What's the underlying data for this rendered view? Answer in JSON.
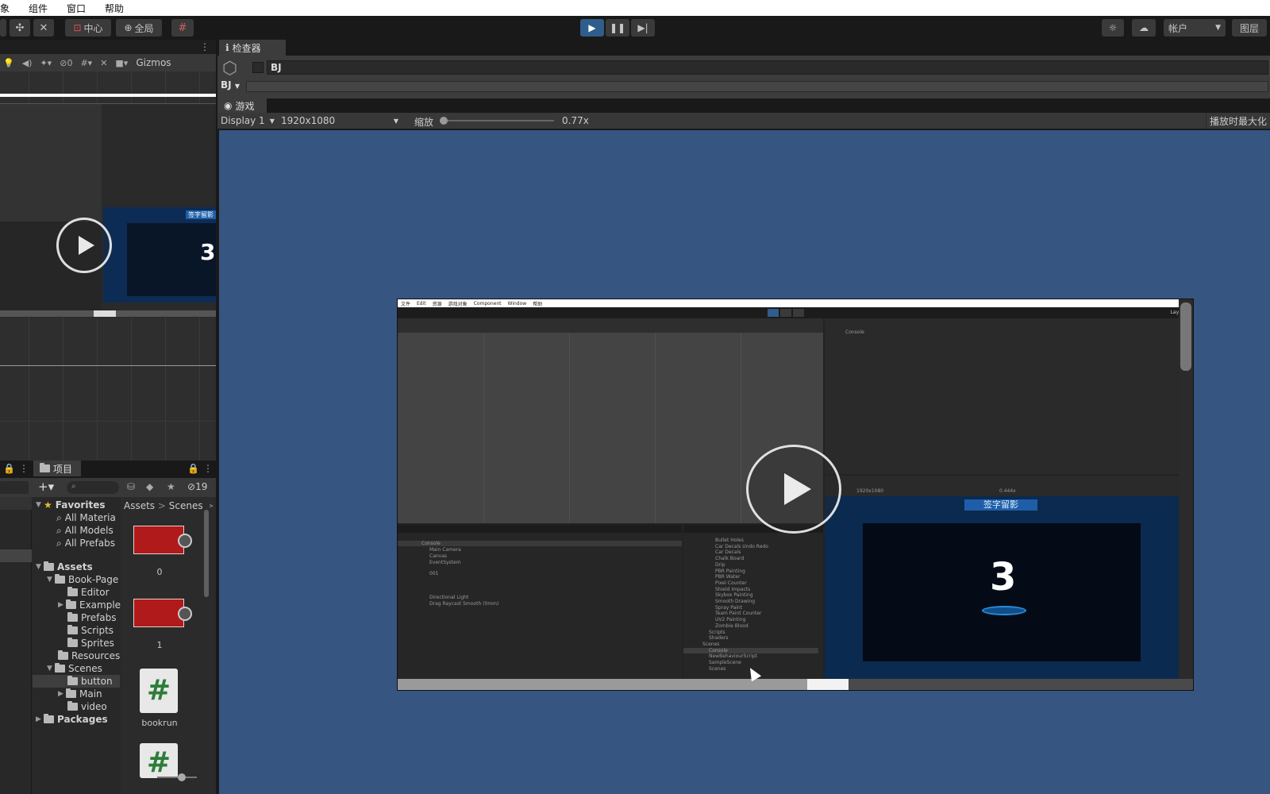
{
  "menu": {
    "items": [
      "象",
      "组件",
      "窗口",
      "帮助"
    ]
  },
  "toolbar": {
    "pivot_label": "中心",
    "global_label": "全局",
    "account_label": "帐户",
    "layers_label": "图层"
  },
  "scene": {
    "gizmos_label": "Gizmos",
    "hidden_count": "0",
    "preview_number": "3",
    "preview_banner": "签字留影"
  },
  "project": {
    "tab_label": "项目",
    "hidden_count": "19",
    "breadcrumb": [
      "Assets",
      "Scenes"
    ],
    "tree": {
      "favorites": "Favorites",
      "fav_items": [
        "All Materia",
        "All Models",
        "All Prefabs"
      ],
      "assets": "Assets",
      "book_page": "Book-Page",
      "book_children": [
        "Editor",
        "Example",
        "Prefabs",
        "Scripts",
        "Sprites"
      ],
      "resources": "Resources",
      "scenes": "Scenes",
      "scene_children": [
        "button",
        "Main",
        "video"
      ],
      "packages": "Packages"
    },
    "assets_grid": [
      {
        "label": "0"
      },
      {
        "label": "1"
      },
      {
        "label": "bookrun"
      }
    ]
  },
  "inspector": {
    "tab_label": "检查器",
    "object_name": "BJ",
    "tag_dropdown": "BJ"
  },
  "game": {
    "tab_label": "游戏",
    "display": "Display 1",
    "resolution": "1920x1080",
    "scale_label": "缩放",
    "scale_value": "0.77x",
    "maximize_label": "播放时最大化"
  },
  "nested": {
    "menu": [
      "文件",
      "Edit",
      "资源",
      "游戏对象",
      "Component",
      "Window",
      "帮助"
    ],
    "console_label": "Console",
    "hierarchy_items": [
      "Console",
      "Main Camera",
      "Canvas",
      "EventSystem",
      "001",
      "Directional Light",
      "Drag Raycast Smooth (0mm)"
    ],
    "project_items": [
      "Bullet Holes",
      "Car Decals Undo Redo",
      "Car Decals",
      "Chalk Board",
      "Drip",
      "PBR Painting",
      "PBR Water",
      "Pixel Counter",
      "Shield Impacts",
      "Skybox Painting",
      "Smooth Drawing",
      "Spray Paint",
      "Team Paint Counter",
      "UV2 Painting",
      "Zombie Blood",
      "Scripts",
      "Shaders",
      "Scenes",
      "Console",
      "NewBehaviourScript",
      "SampleScene",
      "Scenes"
    ],
    "game_res": "1920x1080",
    "game_scale": "0.444x",
    "banner": "签字留影",
    "number": "3",
    "layout_label": "Layout"
  },
  "colors": {
    "game_bg": "#365580",
    "play_active": "#2f5d8c",
    "editor_bg": "#282828"
  }
}
